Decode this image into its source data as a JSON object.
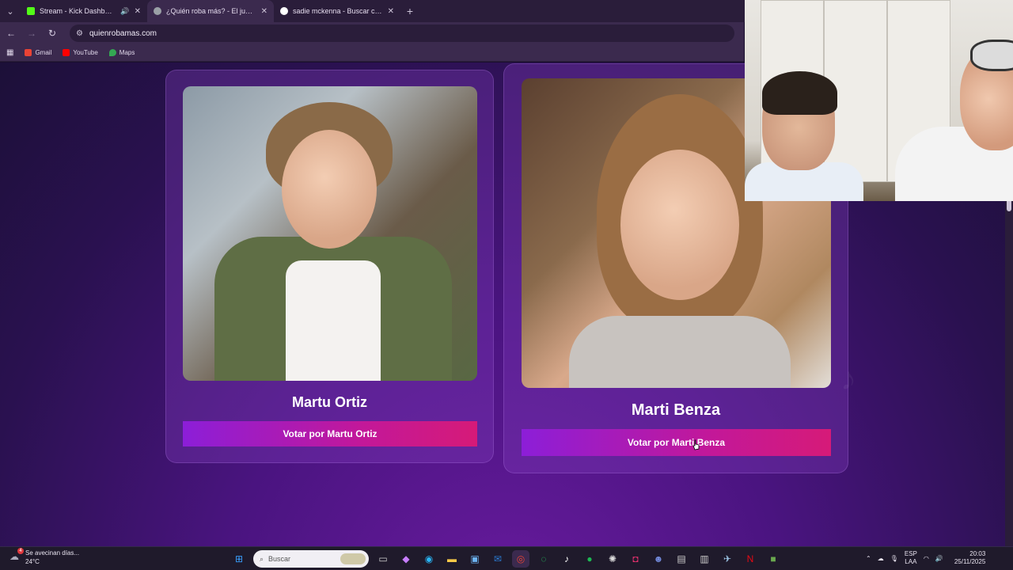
{
  "browser": {
    "tabs": [
      {
        "title": "Stream - Kick Dashboard",
        "favicon_color": "#53fc18",
        "audio": true,
        "active": false
      },
      {
        "title": "¿Quién roba más? - El juego qu",
        "favicon_color": "#9aa0a6",
        "audio": false,
        "active": true
      },
      {
        "title": "sadie mckenna - Buscar con Go",
        "favicon_color": "#4285f4",
        "audio": false,
        "active": false
      }
    ],
    "new_tab_label": "+",
    "url": "quienrobamas.com",
    "bookmarks": [
      {
        "label": "Gmail",
        "color": "#ea4335"
      },
      {
        "label": "YouTube",
        "color": "#ff0000"
      },
      {
        "label": "Maps",
        "color": "#34a853"
      }
    ]
  },
  "page": {
    "candidates": [
      {
        "name": "Martu Ortiz",
        "vote_label": "Votar por Martu Ortiz"
      },
      {
        "name": "Marti Benza",
        "vote_label": "Votar por Marti Benza"
      }
    ],
    "accent_gradient": [
      "#8c1ed8",
      "#d61a78"
    ]
  },
  "taskbar": {
    "weather": {
      "text": "Se avecinan días...",
      "temp": "24°C",
      "badge": "4"
    },
    "search_placeholder": "Buscar",
    "apps": [
      "windows-start",
      "task-view",
      "copilot",
      "edge",
      "file-explorer",
      "store",
      "outlook",
      "chrome",
      "whatsapp",
      "tiktok",
      "spotify",
      "chatgpt",
      "instagram",
      "discord",
      "app",
      "app",
      "steam",
      "netflix",
      "minecraft"
    ],
    "tray": {
      "lang_top": "ESP",
      "lang_bottom": "LAA",
      "time": "20:03",
      "date": "25/11/2025"
    }
  }
}
